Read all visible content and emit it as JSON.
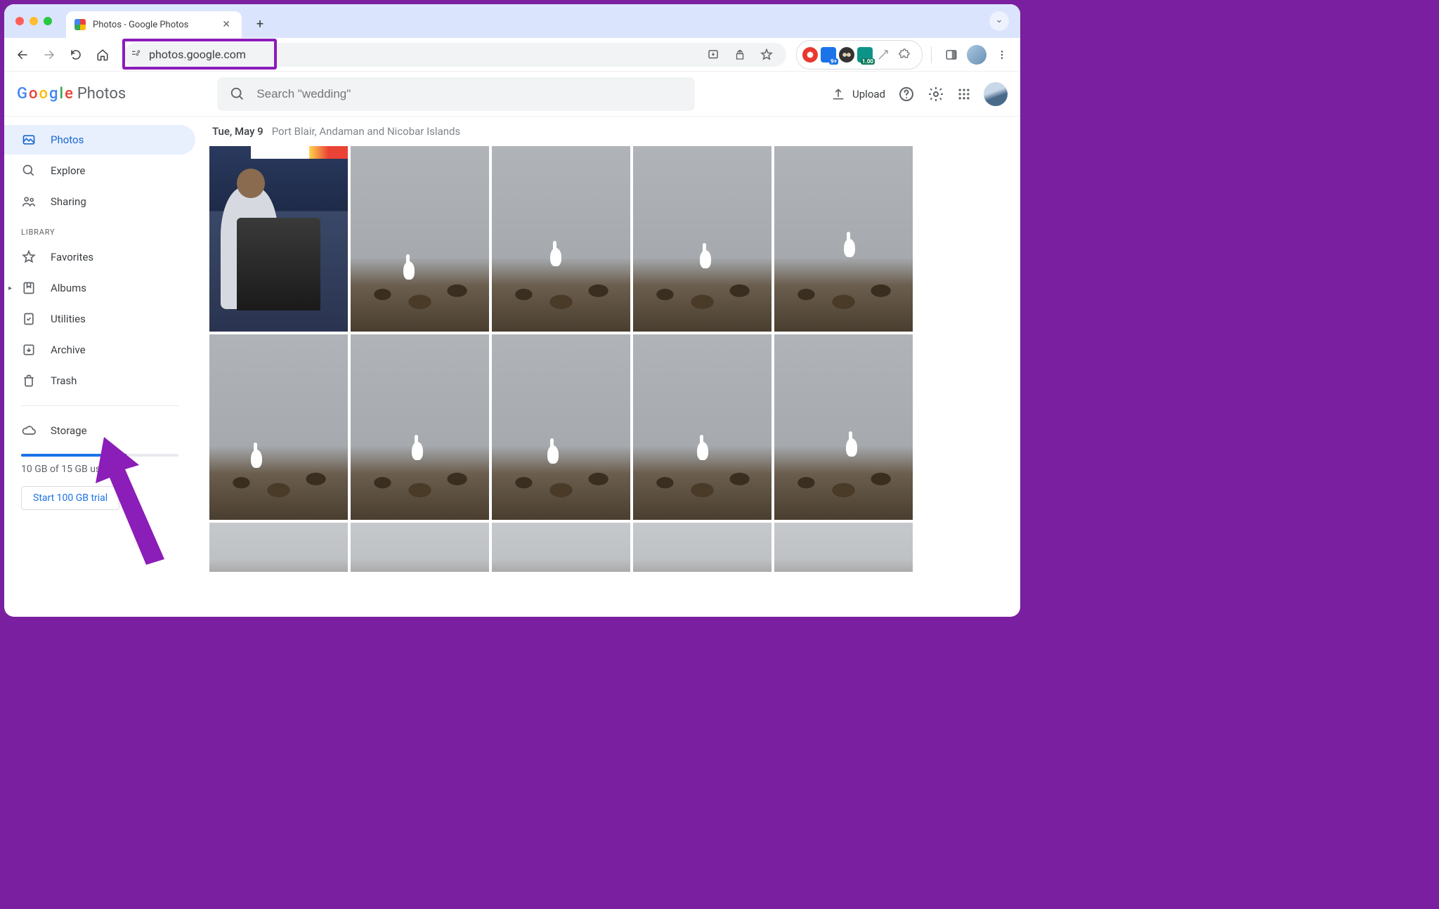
{
  "browser": {
    "tab_title": "Photos - Google Photos",
    "url": "photos.google.com",
    "extensions": {
      "adblock_badge": "",
      "blue_badge": "9+",
      "teal_badge": "1.00"
    }
  },
  "header": {
    "logo_text": "Photos",
    "search_placeholder": "Search \"wedding\"",
    "upload_label": "Upload"
  },
  "sidebar": {
    "items": [
      {
        "label": "Photos",
        "icon": "image"
      },
      {
        "label": "Explore",
        "icon": "search"
      },
      {
        "label": "Sharing",
        "icon": "people"
      }
    ],
    "library_label": "LIBRARY",
    "library_items": [
      {
        "label": "Favorites",
        "icon": "star"
      },
      {
        "label": "Albums",
        "icon": "bookmark"
      },
      {
        "label": "Utilities",
        "icon": "check-square"
      },
      {
        "label": "Archive",
        "icon": "archive"
      },
      {
        "label": "Trash",
        "icon": "trash"
      }
    ],
    "storage": {
      "label": "Storage",
      "used_text": "10 GB of 15 GB used",
      "percent": 67,
      "trial_button": "Start 100 GB trial"
    }
  },
  "content": {
    "date": "Tue, May 9",
    "location": "Port Blair, Andaman and Nicobar Islands"
  }
}
